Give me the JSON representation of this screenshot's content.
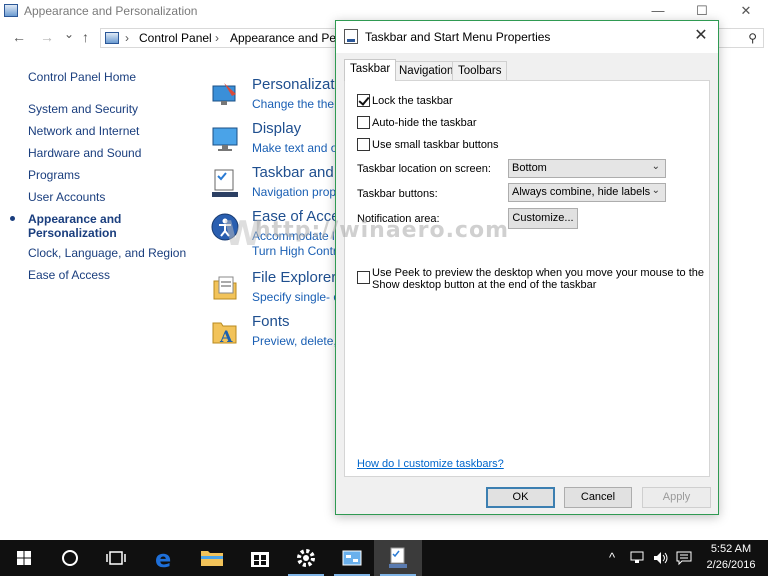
{
  "control_panel": {
    "title": "Appearance and Personalization",
    "window_buttons": {
      "minimize": "—",
      "maximize": "☐",
      "close": "✕"
    },
    "nav": {
      "back": "←",
      "forward": "→",
      "recent": "⌄",
      "up": "↑"
    },
    "breadcrumb": [
      {
        "label": "Control Panel"
      },
      {
        "label": "Appearance and Pers"
      }
    ],
    "breadcrumb_sep": "›",
    "sidebar": {
      "home": "Control Panel Home",
      "items": [
        {
          "label": "System and Security"
        },
        {
          "label": "Network and Internet"
        },
        {
          "label": "Hardware and Sound"
        },
        {
          "label": "Programs"
        },
        {
          "label": "User Accounts"
        },
        {
          "label": "Appearance and",
          "label2": "Personalization",
          "current": true
        },
        {
          "label": "Clock, Language, and Region"
        },
        {
          "label": "Ease of Access"
        }
      ]
    },
    "categories": [
      {
        "title": "Personalizati",
        "sub": "Change the then",
        "icon": "personalization-icon"
      },
      {
        "title": "Display",
        "sub": "Make text and ot",
        "icon": "display-icon"
      },
      {
        "title": "Taskbar and",
        "sub": "Navigation prop",
        "icon": "taskbar-icon"
      },
      {
        "title": "Ease of Acces",
        "sub": "Accommodate lo",
        "sub2": "Turn High Contr",
        "icon": "ease-of-access-icon"
      },
      {
        "title": "File Explorer",
        "sub": "Specify single- o",
        "icon": "file-explorer-icon"
      },
      {
        "title": "Fonts",
        "sub": "Preview, delete, c",
        "icon": "fonts-icon"
      }
    ]
  },
  "dialog": {
    "title": "Taskbar and Start Menu Properties",
    "close": "✕",
    "tabs": [
      "Taskbar",
      "Navigation",
      "Toolbars"
    ],
    "active_tab": "Taskbar",
    "checkboxes": [
      {
        "label": "Lock the taskbar",
        "checked": true
      },
      {
        "label": "Auto-hide the taskbar",
        "checked": false
      },
      {
        "label": "Use small taskbar buttons",
        "checked": false
      }
    ],
    "location_label": "Taskbar location on screen:",
    "location_value": "Bottom",
    "buttons_label": "Taskbar buttons:",
    "buttons_value": "Always combine, hide labels",
    "notification_label": "Notification area:",
    "customize_label": "Customize...",
    "peek": {
      "checked": false,
      "line1": "Use Peek to preview the desktop when you move your mouse to the",
      "line2": "Show desktop button at the end of the taskbar"
    },
    "help_link": "How do I customize taskbars?",
    "ok": "OK",
    "cancel": "Cancel",
    "apply": "Apply"
  },
  "watermark": {
    "text": "http://winaero.com",
    "mark": "W"
  },
  "taskbar": {
    "time": "5:52 AM",
    "date": "2/26/2016",
    "tray_chevron": "^",
    "colors": {
      "background": "#101010",
      "running_indicator": "#7fb4e6",
      "edge_blue": "#1e6fd9"
    }
  }
}
